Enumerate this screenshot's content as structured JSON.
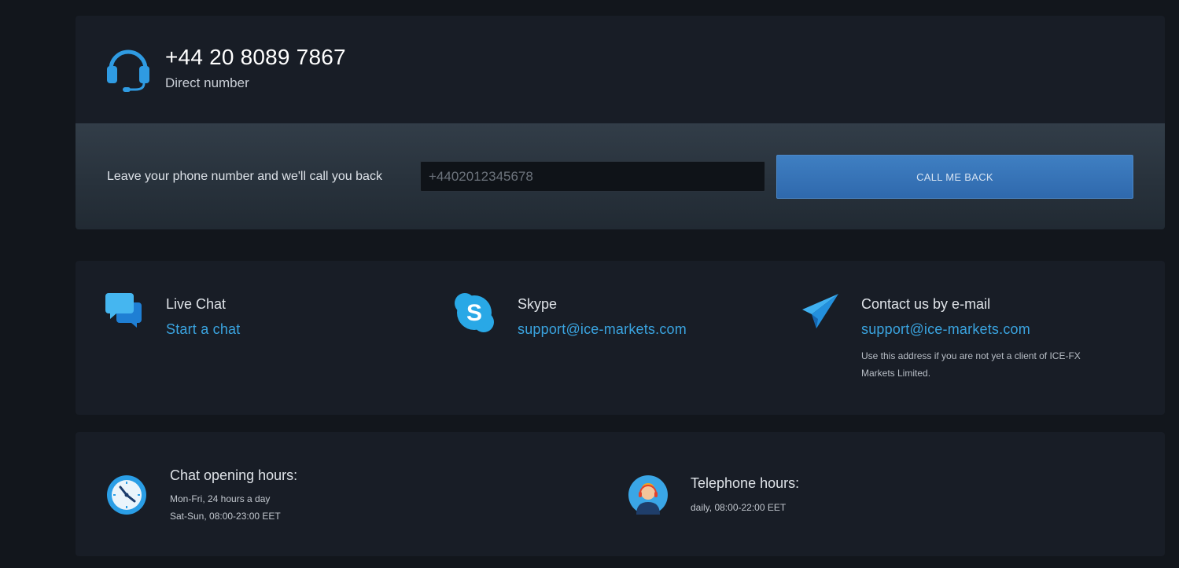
{
  "phone": {
    "number": "+44 20 8089 7867",
    "subtitle": "Direct number",
    "icon": "headset-icon"
  },
  "callback": {
    "label": "Leave your phone number and we'll call you back",
    "input_placeholder": "+4402012345678",
    "input_value": "",
    "button_label": "CALL ME BACK",
    "button_color": "#3474b8"
  },
  "contacts": [
    {
      "icon": "chat-bubbles-icon",
      "title": "Live Chat",
      "link": "Start a chat"
    },
    {
      "icon": "skype-icon",
      "title": "Skype",
      "link": "support@ice-markets.com"
    },
    {
      "icon": "paper-plane-icon",
      "title": "Contact us by e-mail",
      "link": "support@ice-markets.com",
      "note": "Use this address if you are not yet a client of ICE-FX Markets Limited."
    }
  ],
  "hours": {
    "chat": {
      "icon": "clock-icon",
      "title": "Chat opening hours:",
      "lines": [
        "Mon-Fri, 24 hours a day",
        "Sat-Sun, 08:00-23:00 EET"
      ]
    },
    "telephone": {
      "icon": "operator-icon",
      "title": "Telephone hours:",
      "lines": [
        "daily, 08:00-22:00 EET"
      ]
    }
  },
  "colors": {
    "background": "#12161c",
    "card": "#181d26",
    "link": "#3aa4e0",
    "accent_blue": "#3474b8"
  }
}
